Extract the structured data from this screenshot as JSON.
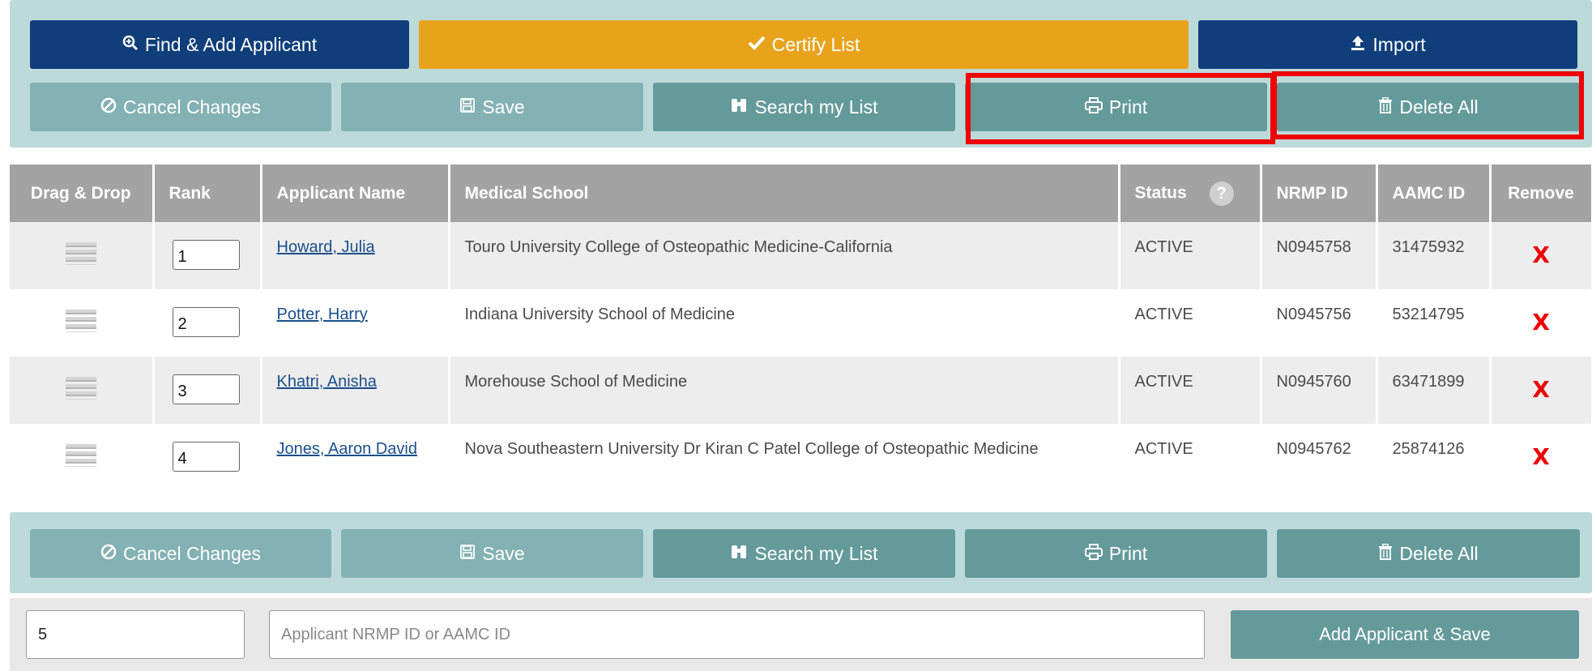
{
  "toolbar_top": {
    "find_add": "Find & Add Applicant",
    "certify": "Certify List",
    "import": "Import",
    "cancel": "Cancel Changes",
    "save": "Save",
    "search": "Search my List",
    "print": "Print",
    "delete_all": "Delete All"
  },
  "table": {
    "headers": {
      "drag": "Drag & Drop",
      "rank": "Rank",
      "name": "Applicant Name",
      "school": "Medical School",
      "status": "Status",
      "nrmp": "NRMP ID",
      "aamc": "AAMC ID",
      "remove": "Remove"
    },
    "rows": [
      {
        "rank": "1",
        "name": "Howard, Julia",
        "school": "Touro University College of Osteopathic Medicine-California",
        "status": "ACTIVE",
        "nrmp": "N0945758",
        "aamc": "31475932",
        "remove": "X"
      },
      {
        "rank": "2",
        "name": "Potter, Harry",
        "school": "Indiana University School of Medicine",
        "status": "ACTIVE",
        "nrmp": "N0945756",
        "aamc": "53214795",
        "remove": "X"
      },
      {
        "rank": "3",
        "name": "Khatri, Anisha",
        "school": "Morehouse School of Medicine",
        "status": "ACTIVE",
        "nrmp": "N0945760",
        "aamc": "63471899",
        "remove": "X"
      },
      {
        "rank": "4",
        "name": "Jones, Aaron David",
        "school": "Nova Southeastern University Dr Kiran C Patel College of Osteopathic Medicine",
        "status": "ACTIVE",
        "nrmp": "N0945762",
        "aamc": "25874126",
        "remove": "X"
      }
    ]
  },
  "toolbar_bottom": {
    "cancel": "Cancel Changes",
    "save": "Save",
    "search": "Search my List",
    "print": "Print",
    "delete_all": "Delete All"
  },
  "add_form": {
    "rank_value": "5",
    "id_placeholder": "Applicant NRMP ID or AAMC ID",
    "submit": "Add Applicant & Save"
  },
  "icons": {
    "find": "zoom-in-icon",
    "certify": "checkmark-icon",
    "import": "upload-icon",
    "cancel": "ban-icon",
    "save": "floppy-disk-icon",
    "search": "binoculars-icon",
    "print": "printer-icon",
    "delete": "trash-icon",
    "drag": "drag-handle-icon",
    "help": "question-circle-icon"
  },
  "colors": {
    "navy": "#0f3e7a",
    "gold": "#e8a31b",
    "teal": "#659a9b",
    "teal_disabled": "#84b1b3",
    "panel": "#bddadb",
    "header": "#a3a3a3",
    "remove": "#ee0000",
    "highlight": "#ee0000"
  }
}
